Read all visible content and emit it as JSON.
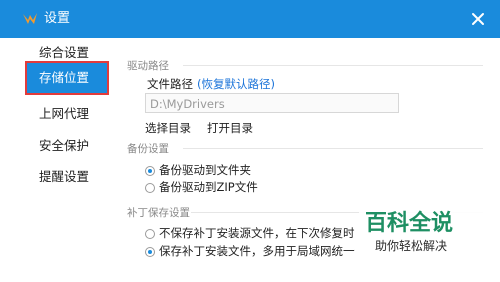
{
  "window": {
    "title": "设置"
  },
  "sidebar": {
    "items": [
      {
        "label": "综合设置"
      },
      {
        "label": "存储位置"
      },
      {
        "label": "上网代理"
      },
      {
        "label": "安全保护"
      },
      {
        "label": "提醒设置"
      }
    ]
  },
  "driver_path": {
    "section_title": "驱动路径",
    "label": "文件路径",
    "restore_default_link": "(恢复默认路径)",
    "value": "D:\\MyDrivers",
    "select_dir_button": "选择目录",
    "open_dir_button": "打开目录"
  },
  "backup": {
    "section_title": "备份设置",
    "options": [
      {
        "label": "备份驱动到文件夹",
        "checked": true
      },
      {
        "label": "备份驱动到ZIP文件",
        "checked": false
      }
    ]
  },
  "patch_save": {
    "section_title": "补丁保存设置",
    "options": [
      {
        "label": "不保存补丁安装源文件，在下次修复时删除补丁",
        "checked": false
      },
      {
        "label": "保存补丁安装文件，多用于局域网统一修复补丁",
        "checked": true
      }
    ]
  },
  "watermark": {
    "main": "百科全说",
    "sub": "助你轻松解决"
  },
  "colors": {
    "titlebar": "#1a8bdc",
    "accent": "#1a8bdc",
    "highlight_box": "#e23b3b",
    "link": "#1a73d9",
    "watermark": "#1e8f63"
  }
}
